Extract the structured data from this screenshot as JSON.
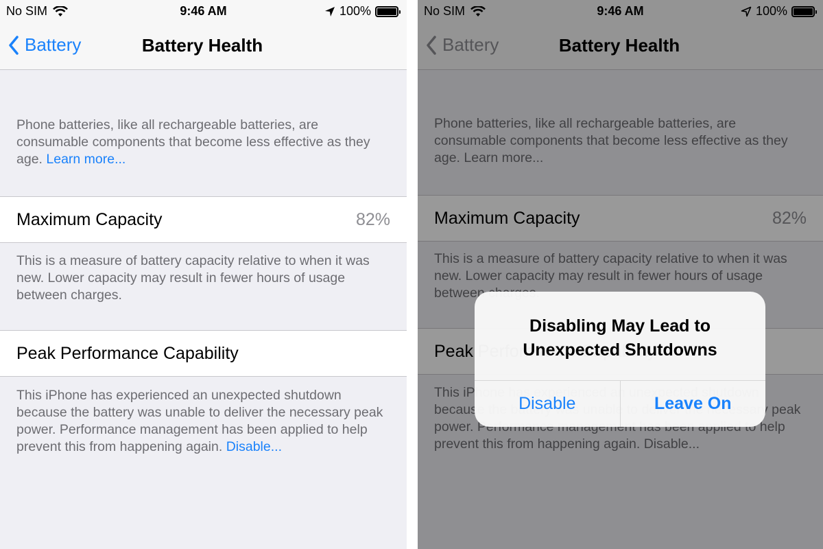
{
  "colors": {
    "accent": "#1a82fb",
    "secondary_text": "#6d6d72",
    "value_text": "#8e8e93"
  },
  "status_bar": {
    "carrier": "No SIM",
    "wifi_icon": "wifi-icon",
    "time": "9:46 AM",
    "location_icon": "location-arrow-icon",
    "battery_percent": "100%",
    "battery_level": 1.0
  },
  "nav": {
    "back_label": "Battery",
    "title": "Battery Health"
  },
  "intro": {
    "text": "Phone batteries, like all rechargeable batteries, are consumable components that become less effective as they age. ",
    "link": "Learn more..."
  },
  "max_capacity": {
    "label": "Maximum Capacity",
    "value": "82%",
    "footer": "This is a measure of battery capacity relative to when it was new. Lower capacity may result in fewer hours of usage between charges."
  },
  "peak_performance": {
    "label": "Peak Performance Capability",
    "footer": "This iPhone has experienced an unexpected shutdown because the battery was unable to deliver the necessary peak power. Performance management has been applied to help prevent this from happening again. ",
    "link": "Disable..."
  },
  "alert": {
    "title": "Disabling May Lead to Unexpected Shutdowns",
    "buttons": [
      {
        "label": "Disable"
      },
      {
        "label": "Leave On"
      }
    ]
  }
}
